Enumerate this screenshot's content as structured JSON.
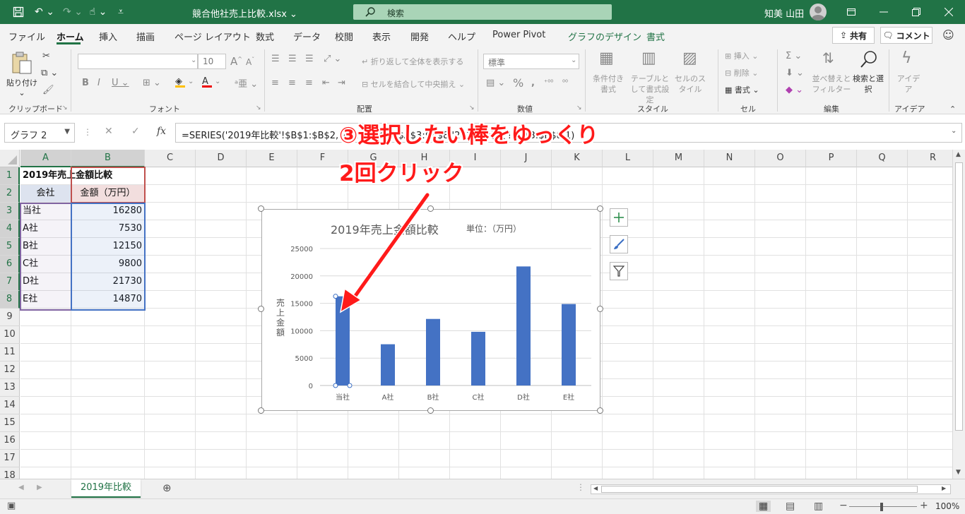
{
  "titlebar": {
    "doc_title": "競合他社売上比較.xlsx",
    "doc_title_caret": "⌄",
    "search_placeholder": "検索",
    "user_name": "知美 山田",
    "accent": "#217346"
  },
  "ribbon_tabs": [
    "ファイル",
    "ホーム",
    "挿入",
    "描画",
    "ページ レイアウト",
    "数式",
    "データ",
    "校閲",
    "表示",
    "開発",
    "ヘルプ",
    "Power Pivot",
    "グラフのデザイン",
    "書式"
  ],
  "share_label": "共有",
  "comment_label": "コメント",
  "ribbon": {
    "clipboard": {
      "paste": "貼り付け",
      "group": "クリップボード"
    },
    "font": {
      "font_name": "",
      "font_size": "10",
      "group": "フォント"
    },
    "alignment": {
      "wrap": "折り返して全体を表示する",
      "merge": "セルを結合して中央揃え",
      "group": "配置"
    },
    "number": {
      "format": "標準",
      "group": "数値"
    },
    "styles": {
      "conditional": "条件付き書式",
      "table": "テーブルとして書式設定",
      "cell_styles": "セルのスタイル",
      "group": "スタイル"
    },
    "cells": {
      "insert": "挿入",
      "delete": "削除",
      "format": "書式",
      "group": "セル"
    },
    "editing": {
      "sort_filter": "並べ替えとフィルター",
      "find_select": "検索と選択",
      "group": "編集"
    },
    "ideas": {
      "label": "アイデア",
      "group": "アイデア"
    }
  },
  "formula_bar": {
    "name_box": "グラフ 2",
    "fx": "fx",
    "formula": "=SERIES('2019年比較'!$B$1:$B$2,'2019年比較'!$A$3:$A$8,'2019年比較'!$B$3:$B$8,1)"
  },
  "columns": [
    "A",
    "B",
    "C",
    "D",
    "E",
    "F",
    "G",
    "H",
    "I",
    "J",
    "K",
    "L",
    "M",
    "N",
    "O",
    "P",
    "Q",
    "R"
  ],
  "rows": [
    "1",
    "2",
    "3",
    "4",
    "5",
    "6",
    "7",
    "8",
    "9",
    "10",
    "11",
    "12",
    "13",
    "14",
    "15",
    "16",
    "17",
    "18"
  ],
  "sheet": {
    "title": "2019年売上金額比較",
    "header_company": "会社",
    "header_amount": "金額（万円）",
    "data": [
      {
        "company": "当社",
        "amount": "16280"
      },
      {
        "company": "A社",
        "amount": "7530"
      },
      {
        "company": "B社",
        "amount": "12150"
      },
      {
        "company": "C社",
        "amount": "9800"
      },
      {
        "company": "D社",
        "amount": "21730"
      },
      {
        "company": "E社",
        "amount": "14870"
      }
    ]
  },
  "chart_data": {
    "type": "bar",
    "title": "2019年売上金額比較",
    "unit_note": "単位：（万円）",
    "ylabel": "売上金額",
    "categories": [
      "当社",
      "A社",
      "B社",
      "C社",
      "D社",
      "E社"
    ],
    "values": [
      16280,
      7530,
      12150,
      9800,
      21730,
      14870
    ],
    "ylim": [
      0,
      25000
    ],
    "yticks": [
      0,
      5000,
      10000,
      15000,
      20000,
      25000
    ],
    "grid": true,
    "bar_color": "#4472c4",
    "selected_index": 0
  },
  "annotation": {
    "line1": "③選択したい棒をゆっくり",
    "line2": "2回クリック",
    "color": "#ff1a1a"
  },
  "sheet_tab": "2019年比較",
  "zoom": "100%"
}
